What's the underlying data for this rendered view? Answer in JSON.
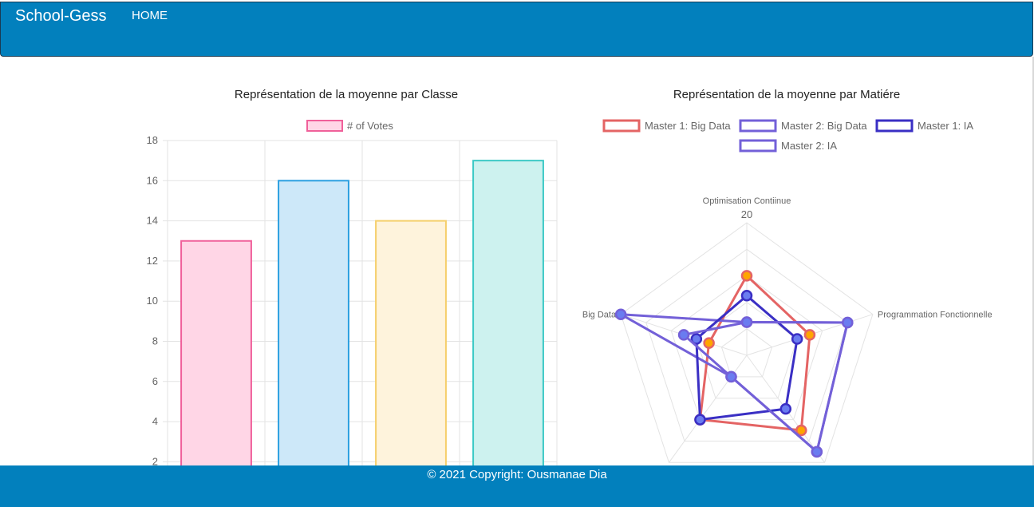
{
  "navbar": {
    "brand": "School-Gess",
    "home_label": "HOME"
  },
  "footer": {
    "copyright": "© 2021 Copyright: Ousmanae Dia"
  },
  "chart_data": [
    {
      "type": "bar",
      "title": "Représentation de la moyenne par Classe",
      "legend": [
        "# of Votes"
      ],
      "series": [
        {
          "name": "# of Votes",
          "values": [
            13,
            16,
            14,
            17
          ]
        }
      ],
      "categories": [
        "",
        "",
        "",
        ""
      ],
      "yticks": [
        "2",
        "4",
        "6",
        "8",
        "10",
        "12",
        "14",
        "16",
        "18"
      ],
      "ylim": [
        0,
        18
      ],
      "grid": true,
      "legend_position": "top",
      "colors": {
        "fills": [
          "#ffd6e6",
          "#cde8f9",
          "#fef3dc",
          "#cdf2ef"
        ],
        "borders": [
          "#f0609a",
          "#2a9fe0",
          "#f5cf6b",
          "#3cc9c5"
        ]
      }
    },
    {
      "type": "radar",
      "title": "Représentation de la moyenne par Matiére",
      "axes": [
        "Optimisation Contiinue",
        "Programmation Fonctionnelle",
        "",
        "",
        "Big Data"
      ],
      "scale_max": 20,
      "scale_tick_label": "20",
      "legend_position": "top",
      "series": [
        {
          "name": "Master 1: Big Data",
          "values": [
            12,
            10,
            14,
            12,
            6
          ],
          "color": "#e46464",
          "point_fill": "#ffa500"
        },
        {
          "name": "Master 2: Big Data",
          "values": [
            5,
            16,
            18,
            4,
            20
          ],
          "color": "#7360d8",
          "point_fill": "#6a7cf0"
        },
        {
          "name": "Master 1: IA",
          "values": [
            9,
            8,
            10,
            12,
            8
          ],
          "color": "#3a2fc4",
          "point_fill": "#6a7cf0"
        },
        {
          "name": "Master 2: IA",
          "values": [
            5,
            16,
            18,
            4,
            10
          ],
          "color": "#7360d8",
          "point_fill": "#6a7cf0"
        }
      ]
    }
  ]
}
